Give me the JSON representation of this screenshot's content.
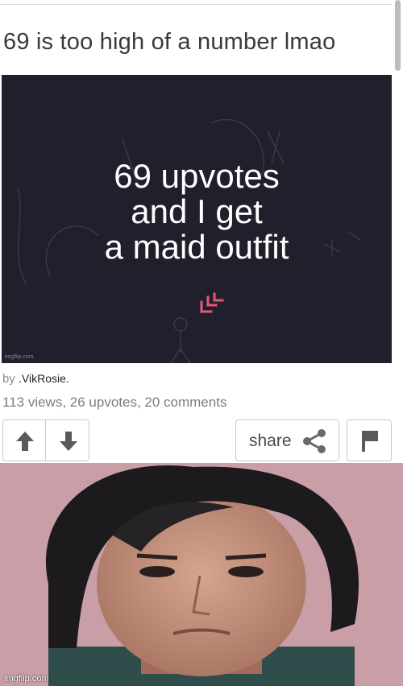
{
  "post": {
    "title": "69 is too high of a number lmao",
    "image_caption_lines": [
      "69 upvotes",
      "and I get",
      "a maid outfit"
    ],
    "image_watermark": "imgflip.com",
    "by_label": "by",
    "username": ".VikRosie.",
    "stats": "113 views, 26 upvotes, 20 comments"
  },
  "actions": {
    "upvote_icon": "arrow-up-icon",
    "downvote_icon": "arrow-down-icon",
    "share_label": "share",
    "share_icon": "share-icon",
    "flag_icon": "flag-icon"
  },
  "reaction_image": {
    "watermark": "imgflip.com"
  },
  "colors": {
    "image_bg": "#221f2c",
    "accent_pink": "#e8567a",
    "button_icon": "#5a5a5a",
    "text_gray": "#7d7d7d"
  }
}
